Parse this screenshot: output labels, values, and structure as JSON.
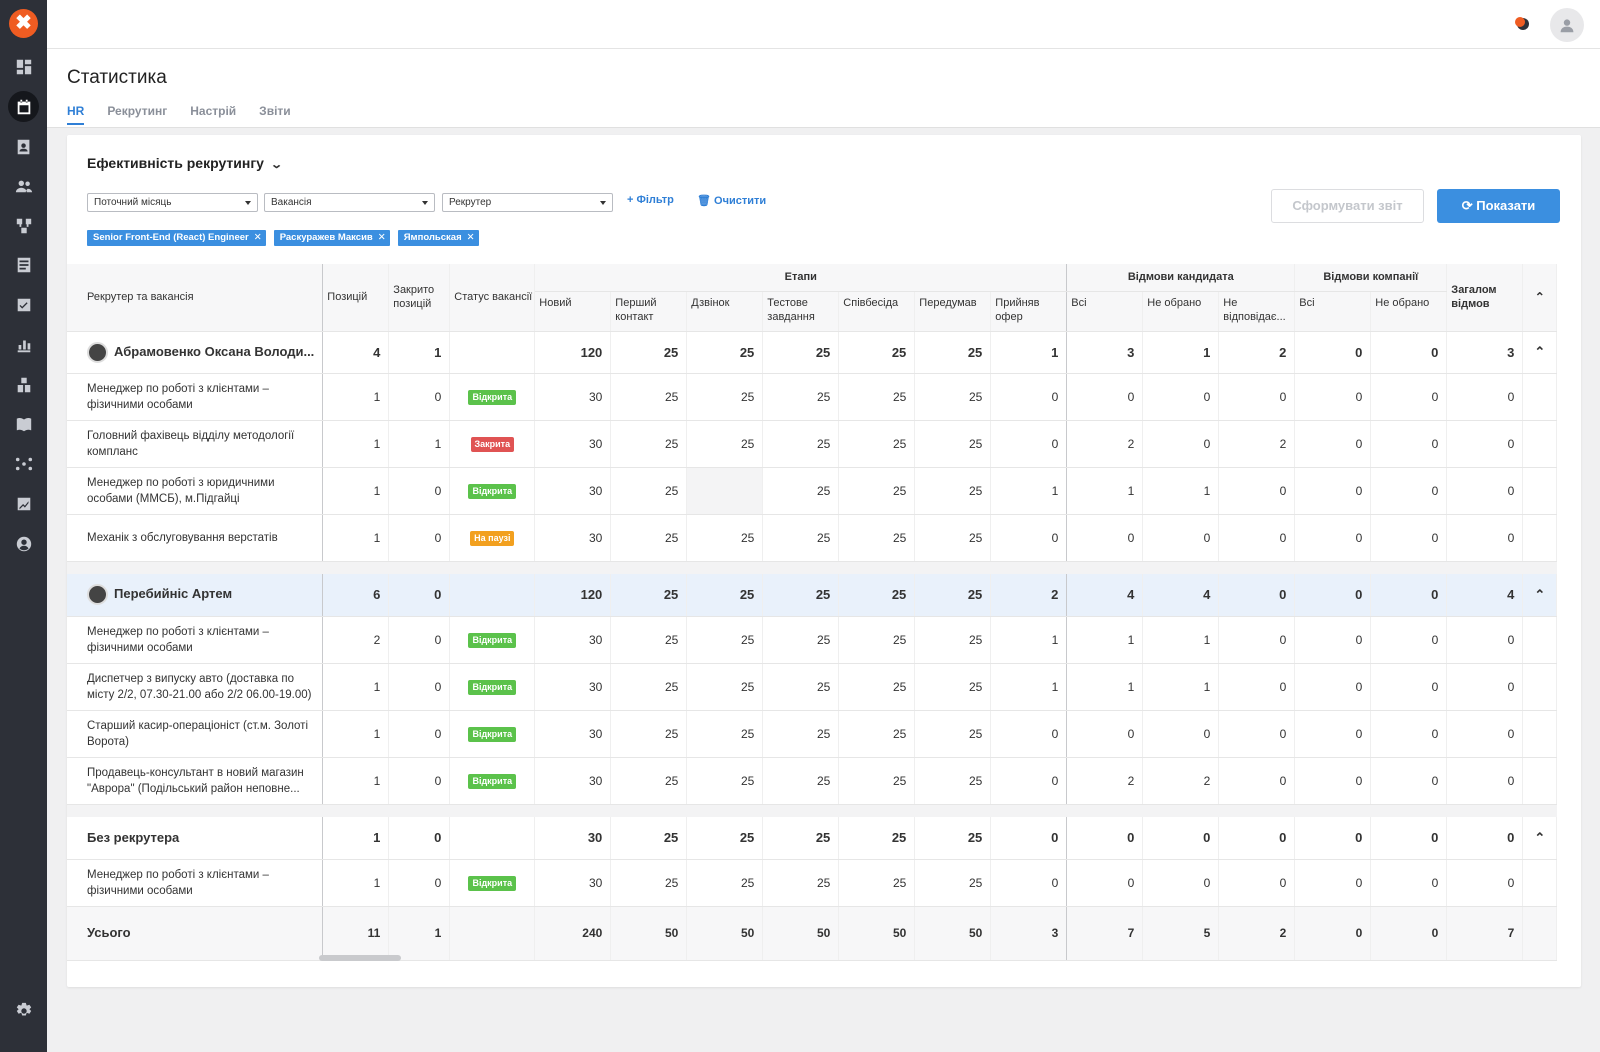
{
  "app": {
    "logo_glyph": "✖"
  },
  "sidebar": {
    "icons": [
      "dashboard-icon",
      "calendar-icon",
      "contacts-icon",
      "people-icon",
      "workflow-icon",
      "news-icon",
      "tasks-icon",
      "chart-icon",
      "org-icon",
      "book-icon",
      "network-icon",
      "analytics-icon",
      "account-icon",
      "settings-icon"
    ]
  },
  "page": {
    "title": "Статистика",
    "tabs": [
      "HR",
      "Рекрутинг",
      "Настрій",
      "Звіти"
    ],
    "active_tab": "HR"
  },
  "report": {
    "title": "Ефективність рекрутингу",
    "filters": {
      "period": "Поточний місяць",
      "vacancy": "Вакансія",
      "recruiter": "Рекрутер"
    },
    "add_filter": "Фільтр",
    "clear": "Очистити",
    "generate_btn": "Сформувати звіт",
    "show_btn": "Показати",
    "chips": [
      "Senior Front-End (React) Engineer",
      "Раскуражев Максив",
      "Ямпольская"
    ]
  },
  "table": {
    "head": {
      "name": "Рекрутер та вакансія",
      "positions": "Позицій",
      "closed": "Закрито позицій",
      "status": "Статус вакансії",
      "stages_group": "Етапи",
      "stages": [
        "Новий",
        "Перший контакт",
        "Дзвінок",
        "Тестове завдання",
        "Співбесіда",
        "Передумав",
        "Прийняв офер"
      ],
      "cand_group": "Відмови кандидата",
      "cand": [
        "Всі",
        "Не обрано",
        "Не відповідає..."
      ],
      "comp_group": "Відмови компанії",
      "comp": [
        "Всі",
        "Не обрано"
      ],
      "total_refusals": "Загалом відмов"
    },
    "groups": [
      {
        "name": "Абрамовенко Оксана Володи...",
        "vals": [
          "4",
          "1",
          "120",
          "25",
          "25",
          "25",
          "25",
          "25",
          "1",
          "3",
          "1",
          "2",
          "0",
          "0",
          "3"
        ],
        "rows": [
          {
            "name": "Менеджер по роботі з клієнтами – фізичними особами",
            "status": "Відкрита",
            "kind": "open",
            "vals": [
              "1",
              "0",
              "30",
              "25",
              "25",
              "25",
              "25",
              "25",
              "0",
              "0",
              "0",
              "0",
              "0",
              "0",
              "0"
            ]
          },
          {
            "name": "Головний фахівець відділу методології компланс",
            "status": "Закрита",
            "kind": "closed",
            "vals": [
              "1",
              "1",
              "30",
              "25",
              "25",
              "25",
              "25",
              "25",
              "0",
              "2",
              "0",
              "2",
              "0",
              "0",
              "0"
            ]
          },
          {
            "name": "Менеджер по роботі з юридичними особами (ММСБ), м.Підгайці",
            "status": "Відкрита",
            "kind": "open",
            "vals": [
              "1",
              "0",
              "30",
              "25",
              "",
              "25",
              "25",
              "25",
              "1",
              "1",
              "1",
              "0",
              "0",
              "0",
              "0"
            ]
          },
          {
            "name": "Механік з обслуговування верстатів",
            "status": "На паузі",
            "kind": "pause",
            "vals": [
              "1",
              "0",
              "30",
              "25",
              "25",
              "25",
              "25",
              "25",
              "0",
              "0",
              "0",
              "0",
              "0",
              "0",
              "0"
            ]
          }
        ]
      },
      {
        "name": "Перебийніс Артем",
        "vals": [
          "6",
          "0",
          "120",
          "25",
          "25",
          "25",
          "25",
          "25",
          "2",
          "4",
          "4",
          "0",
          "0",
          "0",
          "4"
        ],
        "rows": [
          {
            "name": "Менеджер по роботі з клієнтами – фізичними особами",
            "status": "Відкрита",
            "kind": "open",
            "vals": [
              "2",
              "0",
              "30",
              "25",
              "25",
              "25",
              "25",
              "25",
              "1",
              "1",
              "1",
              "0",
              "0",
              "0",
              "0"
            ]
          },
          {
            "name": "Диспетчер з випуску авто (доставка по місту 2/2, 07.30-21.00 або 2/2 06.00-19.00)",
            "status": "Відкрита",
            "kind": "open",
            "vals": [
              "1",
              "0",
              "30",
              "25",
              "25",
              "25",
              "25",
              "25",
              "1",
              "1",
              "1",
              "0",
              "0",
              "0",
              "0"
            ]
          },
          {
            "name": "Старший касир-операціоніст (ст.м. Золоті Ворота)",
            "status": "Відкрита",
            "kind": "open",
            "vals": [
              "1",
              "0",
              "30",
              "25",
              "25",
              "25",
              "25",
              "25",
              "0",
              "0",
              "0",
              "0",
              "0",
              "0",
              "0"
            ]
          },
          {
            "name": "Продавець-консультант в новий магазин \"Аврора\" (Подільський район неповне...",
            "status": "Відкрита",
            "kind": "open",
            "vals": [
              "1",
              "0",
              "30",
              "25",
              "25",
              "25",
              "25",
              "25",
              "0",
              "2",
              "2",
              "0",
              "0",
              "0",
              "0"
            ]
          }
        ]
      },
      {
        "name": "Без рекрутера",
        "vals": [
          "1",
          "0",
          "30",
          "25",
          "25",
          "25",
          "25",
          "25",
          "0",
          "0",
          "0",
          "0",
          "0",
          "0",
          "0"
        ],
        "rows": [
          {
            "name": "Менеджер по роботі з клієнтами – фізичними особами",
            "status": "Відкрита",
            "kind": "open",
            "vals": [
              "1",
              "0",
              "30",
              "25",
              "25",
              "25",
              "25",
              "25",
              "0",
              "0",
              "0",
              "0",
              "0",
              "0",
              "0"
            ]
          }
        ]
      }
    ],
    "total": {
      "label": "Усього",
      "vals": [
        "11",
        "1",
        "240",
        "50",
        "50",
        "50",
        "50",
        "50",
        "3",
        "7",
        "5",
        "2",
        "0",
        "0",
        "7"
      ]
    }
  }
}
